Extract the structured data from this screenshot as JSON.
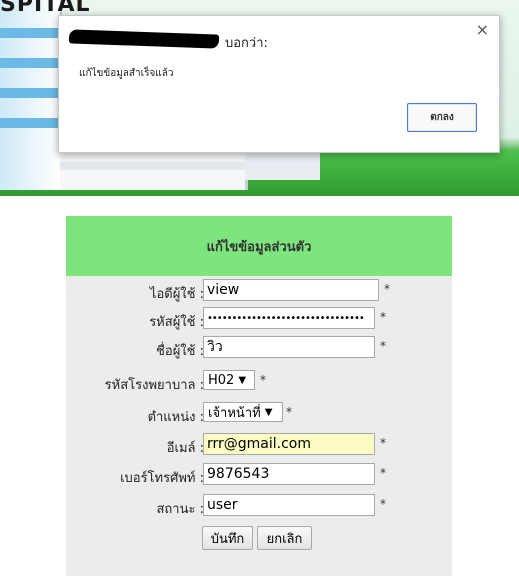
{
  "background": {
    "sign_text": "SPITAL"
  },
  "dialog": {
    "origin_suffix": "บอกว่า:",
    "message": "แก้ไขข้อมูลสำเร็จแล้ว",
    "ok_label": "ตกลง",
    "close_symbol": "×"
  },
  "form": {
    "title": "แก้ไขข้อมูลส่วนตัว",
    "fields": [
      {
        "label": "ไอดีผู้ใช้ :",
        "value": "view",
        "required": "*"
      },
      {
        "label": "รหัสผู้ใช้ :",
        "value": "••••••••••••••••••••••••••••••••",
        "required": "*"
      },
      {
        "label": "ชื่อผู้ใช้ :",
        "value": "วิว",
        "required": "*"
      },
      {
        "label": "รหัสโรงพยาบาล :",
        "value": "H02",
        "required": "*"
      },
      {
        "label": "ตำแหน่ง :",
        "value": "เจ้าหน้าที่",
        "required": "*"
      },
      {
        "label": "อีเมล์ :",
        "value": "rrr@gmail.com",
        "required": "*"
      },
      {
        "label": "เบอร์โทรศัพท์ :",
        "value": "9876543",
        "required": "*"
      },
      {
        "label": "สถานะ :",
        "value": "user",
        "required": "*"
      }
    ],
    "save_label": "บันทึก",
    "cancel_label": "ยกเลิก",
    "caret": "▼"
  }
}
